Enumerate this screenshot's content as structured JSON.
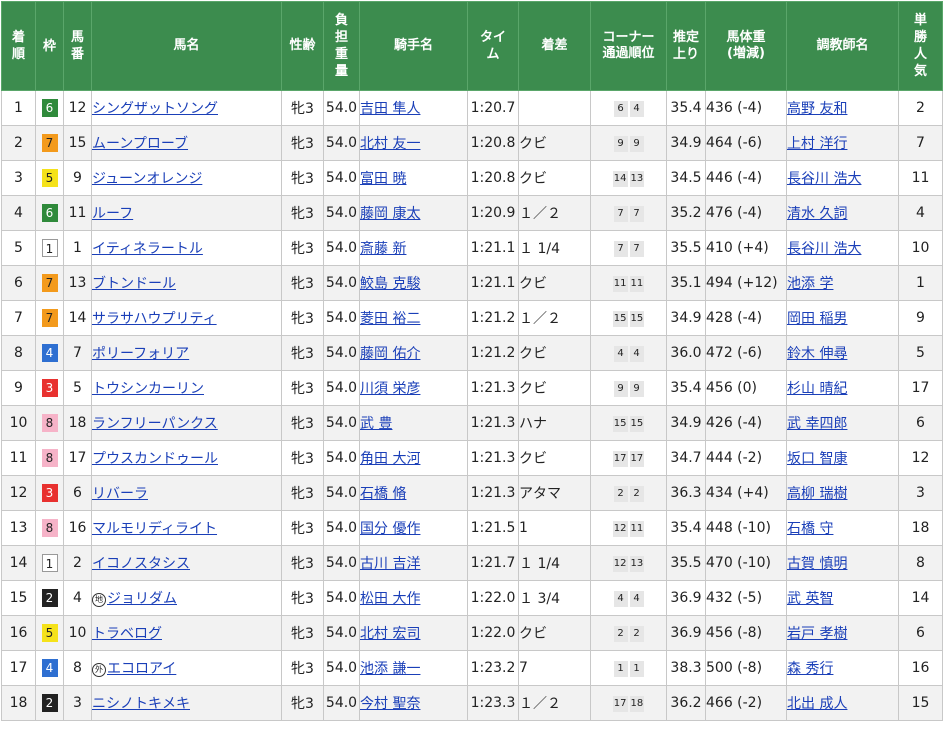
{
  "headers": {
    "finish": "着順",
    "frame": "枠",
    "number": "馬番",
    "horse": "馬名",
    "sexage": "性齢",
    "weight": "負担重量",
    "jockey": "騎手名",
    "time": "タイム",
    "margin": "着差",
    "corner_line1": "コーナー",
    "corner_line2": "通過順位",
    "last3f": "推定上り",
    "body_line1": "馬体重",
    "body_line2": "(増減)",
    "trainer": "調教師名",
    "pop": "単勝人気"
  },
  "frame_colors": {
    "1": "#ffffff",
    "2": "#222222",
    "3": "#e8312f",
    "4": "#2e6fd1",
    "5": "#f5e21a",
    "6": "#2f8a3b",
    "7": "#f39a1c",
    "8": "#f6b3c8"
  },
  "rows": [
    {
      "finish": "1",
      "frame": "6",
      "number": "12",
      "badge": "",
      "horse": "シングザットソング",
      "sexage": "牝3",
      "weight": "54.0",
      "jockey": "吉田 隼人",
      "time": "1:20.7",
      "margin": "",
      "corner": [
        "6",
        "4"
      ],
      "last3f": "35.4",
      "body": "436 (-4)",
      "trainer": "高野 友和",
      "pop": "2"
    },
    {
      "finish": "2",
      "frame": "7",
      "number": "15",
      "badge": "",
      "horse": "ムーンプローブ",
      "sexage": "牝3",
      "weight": "54.0",
      "jockey": "北村 友一",
      "time": "1:20.8",
      "margin": "クビ",
      "corner": [
        "9",
        "9"
      ],
      "last3f": "34.9",
      "body": "464 (-6)",
      "trainer": "上村 洋行",
      "pop": "7"
    },
    {
      "finish": "3",
      "frame": "5",
      "number": "9",
      "badge": "",
      "horse": "ジューンオレンジ",
      "sexage": "牝3",
      "weight": "54.0",
      "jockey": "富田 暁",
      "time": "1:20.8",
      "margin": "クビ",
      "corner": [
        "14",
        "13"
      ],
      "last3f": "34.5",
      "body": "446 (-4)",
      "trainer": "長谷川 浩大",
      "pop": "11"
    },
    {
      "finish": "4",
      "frame": "6",
      "number": "11",
      "badge": "",
      "horse": "ルーフ",
      "sexage": "牝3",
      "weight": "54.0",
      "jockey": "藤岡 康太",
      "time": "1:20.9",
      "margin": "１／２",
      "corner": [
        "7",
        "7"
      ],
      "last3f": "35.2",
      "body": "476 (-4)",
      "trainer": "清水 久詞",
      "pop": "4"
    },
    {
      "finish": "5",
      "frame": "1",
      "number": "1",
      "badge": "",
      "horse": "イティネラートル",
      "sexage": "牝3",
      "weight": "54.0",
      "jockey": "斎藤 新",
      "time": "1:21.1",
      "margin": "１ 1/4",
      "corner": [
        "7",
        "7"
      ],
      "last3f": "35.5",
      "body": "410 (+4)",
      "trainer": "長谷川 浩大",
      "pop": "10"
    },
    {
      "finish": "6",
      "frame": "7",
      "number": "13",
      "badge": "",
      "horse": "ブトンドール",
      "sexage": "牝3",
      "weight": "54.0",
      "jockey": "鮫島 克駿",
      "time": "1:21.1",
      "margin": "クビ",
      "corner": [
        "11",
        "11"
      ],
      "last3f": "35.1",
      "body": "494 (+12)",
      "trainer": "池添 学",
      "pop": "1"
    },
    {
      "finish": "7",
      "frame": "7",
      "number": "14",
      "badge": "",
      "horse": "サラサハウプリティ",
      "sexage": "牝3",
      "weight": "54.0",
      "jockey": "菱田 裕二",
      "time": "1:21.2",
      "margin": "１／２",
      "corner": [
        "15",
        "15"
      ],
      "last3f": "34.9",
      "body": "428 (-4)",
      "trainer": "岡田 稲男",
      "pop": "9"
    },
    {
      "finish": "8",
      "frame": "4",
      "number": "7",
      "badge": "",
      "horse": "ポリーフォリア",
      "sexage": "牝3",
      "weight": "54.0",
      "jockey": "藤岡 佑介",
      "time": "1:21.2",
      "margin": "クビ",
      "corner": [
        "4",
        "4"
      ],
      "last3f": "36.0",
      "body": "472 (-6)",
      "trainer": "鈴木 伸尋",
      "pop": "5"
    },
    {
      "finish": "9",
      "frame": "3",
      "number": "5",
      "badge": "",
      "horse": "トウシンカーリン",
      "sexage": "牝3",
      "weight": "54.0",
      "jockey": "川須 栄彦",
      "time": "1:21.3",
      "margin": "クビ",
      "corner": [
        "9",
        "9"
      ],
      "last3f": "35.4",
      "body": "456 (0)",
      "trainer": "杉山 晴紀",
      "pop": "17"
    },
    {
      "finish": "10",
      "frame": "8",
      "number": "18",
      "badge": "",
      "horse": "ランフリーパンクス",
      "sexage": "牝3",
      "weight": "54.0",
      "jockey": "武 豊",
      "time": "1:21.3",
      "margin": "ハナ",
      "corner": [
        "15",
        "15"
      ],
      "last3f": "34.9",
      "body": "426 (-4)",
      "trainer": "武 幸四郎",
      "pop": "6"
    },
    {
      "finish": "11",
      "frame": "8",
      "number": "17",
      "badge": "",
      "horse": "プウスカンドゥール",
      "sexage": "牝3",
      "weight": "54.0",
      "jockey": "角田 大河",
      "time": "1:21.3",
      "margin": "クビ",
      "corner": [
        "17",
        "17"
      ],
      "last3f": "34.7",
      "body": "444 (-2)",
      "trainer": "坂口 智康",
      "pop": "12"
    },
    {
      "finish": "12",
      "frame": "3",
      "number": "6",
      "badge": "",
      "horse": "リバーラ",
      "sexage": "牝3",
      "weight": "54.0",
      "jockey": "石橋 脩",
      "time": "1:21.3",
      "margin": "アタマ",
      "corner": [
        "2",
        "2"
      ],
      "last3f": "36.3",
      "body": "434 (+4)",
      "trainer": "高柳 瑞樹",
      "pop": "3"
    },
    {
      "finish": "13",
      "frame": "8",
      "number": "16",
      "badge": "",
      "horse": "マルモリディライト",
      "sexage": "牝3",
      "weight": "54.0",
      "jockey": "国分 優作",
      "time": "1:21.5",
      "margin": "1",
      "corner": [
        "12",
        "11"
      ],
      "last3f": "35.4",
      "body": "448 (-10)",
      "trainer": "石橋 守",
      "pop": "18"
    },
    {
      "finish": "14",
      "frame": "1",
      "number": "2",
      "badge": "",
      "horse": "イコノスタシス",
      "sexage": "牝3",
      "weight": "54.0",
      "jockey": "古川 吉洋",
      "time": "1:21.7",
      "margin": "１ 1/4",
      "corner": [
        "12",
        "13"
      ],
      "last3f": "35.5",
      "body": "470 (-10)",
      "trainer": "古賀 慎明",
      "pop": "8"
    },
    {
      "finish": "15",
      "frame": "2",
      "number": "4",
      "badge": "地",
      "horse": "ジョリダム",
      "sexage": "牝3",
      "weight": "54.0",
      "jockey": "松田 大作",
      "time": "1:22.0",
      "margin": "１ 3/4",
      "corner": [
        "4",
        "4"
      ],
      "last3f": "36.9",
      "body": "432 (-5)",
      "trainer": "武 英智",
      "pop": "14"
    },
    {
      "finish": "16",
      "frame": "5",
      "number": "10",
      "badge": "",
      "horse": "トラベログ",
      "sexage": "牝3",
      "weight": "54.0",
      "jockey": "北村 宏司",
      "time": "1:22.0",
      "margin": "クビ",
      "corner": [
        "2",
        "2"
      ],
      "last3f": "36.9",
      "body": "456 (-8)",
      "trainer": "岩戸 孝樹",
      "pop": "6"
    },
    {
      "finish": "17",
      "frame": "4",
      "number": "8",
      "badge": "外",
      "horse": "エコロアイ",
      "sexage": "牝3",
      "weight": "54.0",
      "jockey": "池添 謙一",
      "time": "1:23.2",
      "margin": "7",
      "corner": [
        "1",
        "1"
      ],
      "last3f": "38.3",
      "body": "500 (-8)",
      "trainer": "森 秀行",
      "pop": "16"
    },
    {
      "finish": "18",
      "frame": "2",
      "number": "3",
      "badge": "",
      "horse": "ニシノトキメキ",
      "sexage": "牝3",
      "weight": "54.0",
      "jockey": "今村 聖奈",
      "time": "1:23.3",
      "margin": "１／２",
      "corner": [
        "17",
        "18"
      ],
      "last3f": "36.2",
      "body": "466 (-2)",
      "trainer": "北出 成人",
      "pop": "15"
    }
  ]
}
